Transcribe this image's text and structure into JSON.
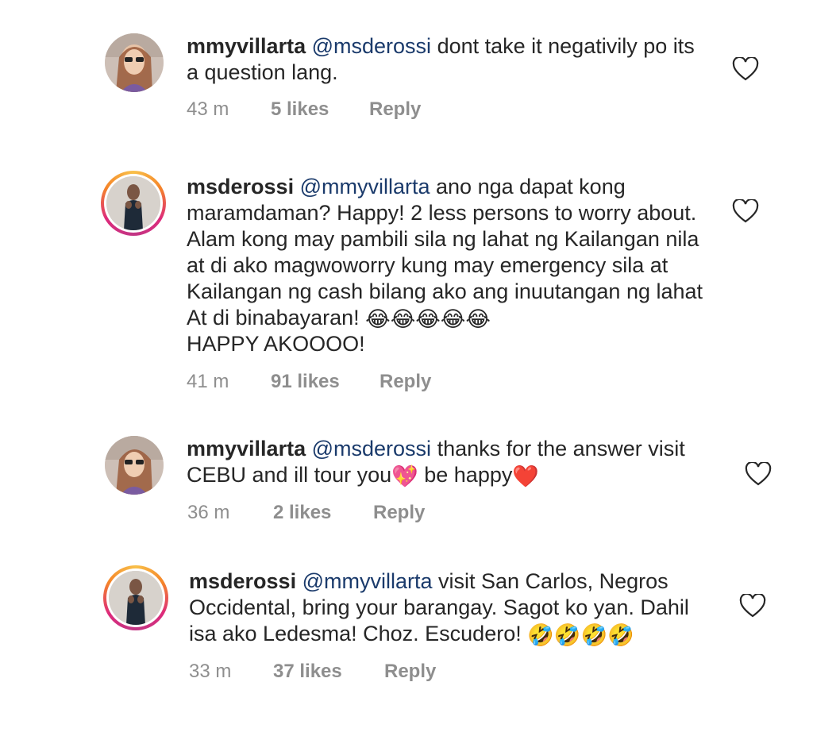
{
  "comments": [
    {
      "username": "mmyvillarta",
      "mention": "@msderossi",
      "text": " dont take it negativily po its a question lang.",
      "emojis": "",
      "time": "43 m",
      "likes": "5 likes",
      "reply": "Reply"
    },
    {
      "username": "msderossi",
      "mention": "@mmyvillarta",
      "text": " ano nga dapat kong maramdaman? Happy! 2 less persons to worry about. Alam kong may pambili sila ng lahat ng Kailangan nila at di ako magwoworry kung may emergency sila at Kailangan ng cash bilang ako ang inuutangan ng lahat At di binabayaran! ",
      "emojis": "😂😂😂😂😂",
      "tail": " HAPPY AKOOOO!",
      "time": "41 m",
      "likes": "91 likes",
      "reply": "Reply"
    },
    {
      "username": "mmyvillarta",
      "mention": "@msderossi",
      "text": " thanks for the answer visit CEBU and ill tour you",
      "emoji1": "💖",
      "text2": " be happy",
      "emoji2": "❤️",
      "time": "36 m",
      "likes": "2 likes",
      "reply": "Reply"
    },
    {
      "username": "msderossi",
      "mention": "@mmyvillarta",
      "text": " visit San Carlos, Negros Occidental, bring your barangay. Sagot ko yan. Dahil isa ako Ledesma! Choz. Escudero! ",
      "emojis": "🤣🤣🤣🤣",
      "time": "33 m",
      "likes": "37 likes",
      "reply": "Reply"
    }
  ],
  "icons": {
    "like": "heart-outline-icon"
  },
  "colors": {
    "mention": "#1a3a6b",
    "meta": "#8e8e8e",
    "story_ring": "#dd2a7b"
  }
}
